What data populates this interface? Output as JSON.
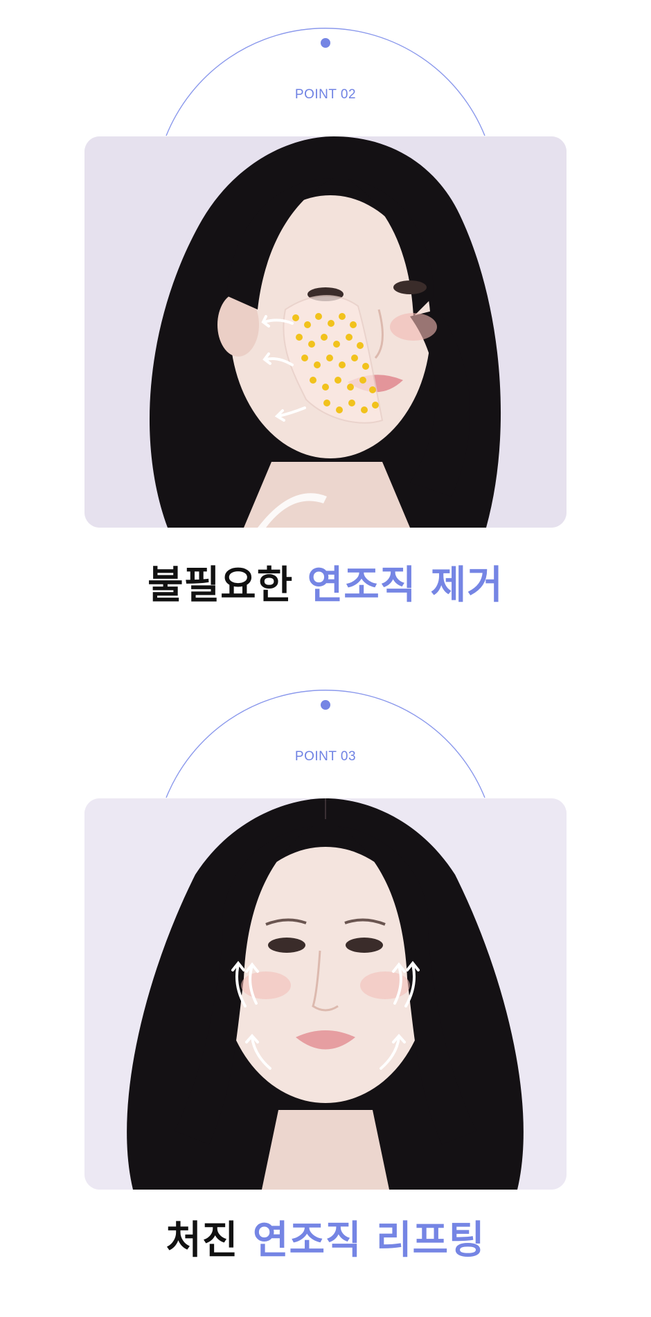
{
  "colors": {
    "accent": "#7585e4",
    "arc": "#8a98ec",
    "card_bg_a": "#e6e1ee",
    "card_bg_b": "#ece8f3",
    "hair": "#141114",
    "skin": "#f3e2db",
    "dots": "#f1c21c"
  },
  "sections": [
    {
      "point_label": "POINT 02",
      "headline_dark": "불필요한",
      "headline_accent": "연조직 제거",
      "photo_icon": "face-with-cheek-fat-dots-illustration"
    },
    {
      "point_label": "POINT 03",
      "headline_dark": "처진",
      "headline_accent": "연조직 리프팅",
      "photo_icon": "face-with-lifting-arrows-illustration"
    }
  ]
}
